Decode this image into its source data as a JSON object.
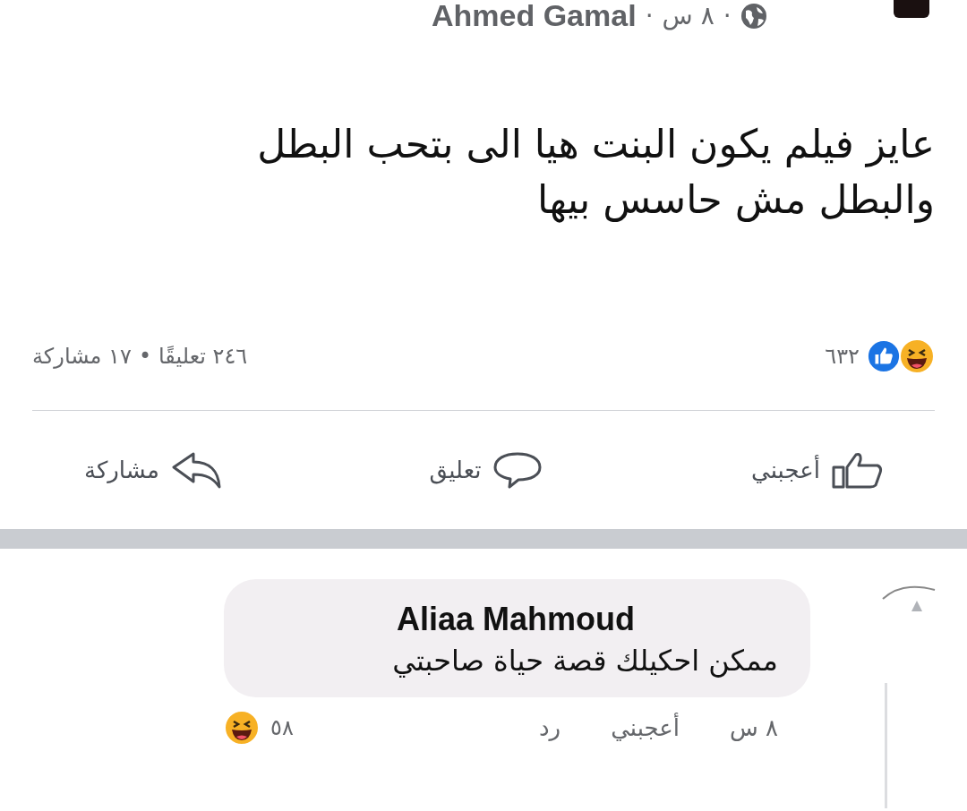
{
  "header": {
    "author": "Ahmed Gamal",
    "time": "٨ س",
    "separator": "·"
  },
  "post": {
    "text": "عايز فيلم يكون البنت هيا الى بتحب البطل والبطل مش حاسس بيها"
  },
  "stats": {
    "reactions_count": "٦٣٢",
    "comments": "٢٤٦ تعليقًا",
    "separator": "•",
    "shares": "١٧ مشاركة"
  },
  "actions": [
    {
      "kind": "like",
      "label": "أعجبني"
    },
    {
      "kind": "comment",
      "label": "تعليق"
    },
    {
      "kind": "share",
      "label": "مشاركة"
    }
  ],
  "comment": {
    "author": "Aliaa Mahmoud",
    "text": "ممكن احكيلك قصة حياة صاحبتي",
    "time": "٨ س",
    "like": "أعجبني",
    "reply": "رد",
    "reactions_count": "٥٨"
  }
}
